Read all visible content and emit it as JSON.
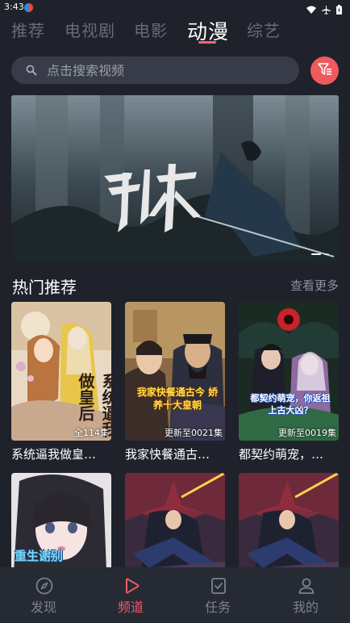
{
  "status_bar": {
    "time": "3:43"
  },
  "top_tabs": [
    {
      "label": "推荐",
      "active": false
    },
    {
      "label": "电视剧",
      "active": false
    },
    {
      "label": "电影",
      "active": false
    },
    {
      "label": "动漫",
      "active": true
    },
    {
      "label": "综艺",
      "active": false
    }
  ],
  "search": {
    "placeholder": "点击搜索视频",
    "icon": "search-icon"
  },
  "filter": {
    "icon": "filter-icon",
    "color": "#ef5a5e"
  },
  "banner": {
    "title_art": "剑来",
    "slide_count": 2,
    "active_slide": 1
  },
  "section": {
    "title": "热门推荐",
    "more_label": "查看更多"
  },
  "cards": [
    {
      "title": "系统逼我做皇…",
      "episodes": "全114集",
      "cover_text": "系统逼我做皇后"
    },
    {
      "title": "我家快餐通古…",
      "episodes": "更新至0021集",
      "cover_text": "我家快餐通古今 娇养十大皇朝"
    },
    {
      "title": "都契约萌宠，…",
      "episodes": "更新至0019集",
      "cover_text": "都契约萌宠，你返祖上古大凶？"
    },
    {
      "title": "",
      "episodes": "",
      "cover_text": "重生谢别"
    },
    {
      "title": "",
      "episodes": "",
      "cover_text": ""
    },
    {
      "title": "",
      "episodes": "",
      "cover_text": ""
    }
  ],
  "bottom_nav": [
    {
      "label": "发现",
      "icon": "compass-icon",
      "active": false
    },
    {
      "label": "频道",
      "icon": "play-icon",
      "active": true
    },
    {
      "label": "任务",
      "icon": "task-icon",
      "active": false
    },
    {
      "label": "我的",
      "icon": "user-icon",
      "active": false
    }
  ],
  "colors": {
    "background": "#1f222b",
    "accent": "#f05a68",
    "search_bg": "#383c48"
  }
}
